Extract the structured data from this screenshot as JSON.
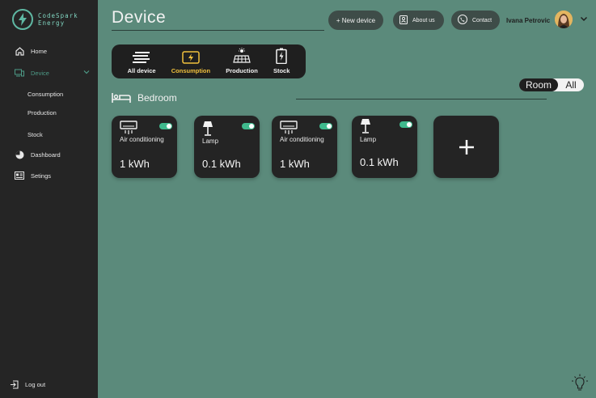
{
  "brand": {
    "line1": "CodeSpark",
    "line2": "Energy"
  },
  "sidebar": {
    "home": "Home",
    "device": "Device",
    "sub": [
      "Consumption",
      "Production",
      "Stock"
    ],
    "dashboard": "Dashboard",
    "settings": "Setings",
    "logout": "Log out"
  },
  "header": {
    "title": "Device",
    "new_device": "+ New device",
    "about": "About us",
    "contact": "Contact",
    "user": "Ivana Petrovic"
  },
  "filters": [
    {
      "label": "All device",
      "icon": "bars-icon"
    },
    {
      "label": "Consumption",
      "icon": "flash-icon"
    },
    {
      "label": "Production",
      "icon": "solar-panel-icon"
    },
    {
      "label": "Stock",
      "icon": "battery-icon"
    }
  ],
  "active_filter": "Consumption",
  "view_toggle": {
    "room": "Room",
    "all": "All",
    "selected": "Room"
  },
  "room": {
    "name": "Bedroom"
  },
  "devices": [
    {
      "name": "Air conditioning",
      "value": "1 kWh",
      "on": true,
      "icon": "air-conditioner-icon"
    },
    {
      "name": "Lamp",
      "value": "0.1 kWh",
      "on": true,
      "icon": "lamp-icon"
    },
    {
      "name": "Air conditioning",
      "value": "1 kWh",
      "on": true,
      "icon": "air-conditioner-icon"
    },
    {
      "name": "Lamp",
      "value": "0.1 kWh",
      "on": true,
      "icon": "lamp-icon"
    }
  ],
  "colors": {
    "accent": "#4d9a86",
    "active_filter": "#f0c03d",
    "toggle_on": "#3fb98d",
    "background": "#5b8a7b"
  }
}
